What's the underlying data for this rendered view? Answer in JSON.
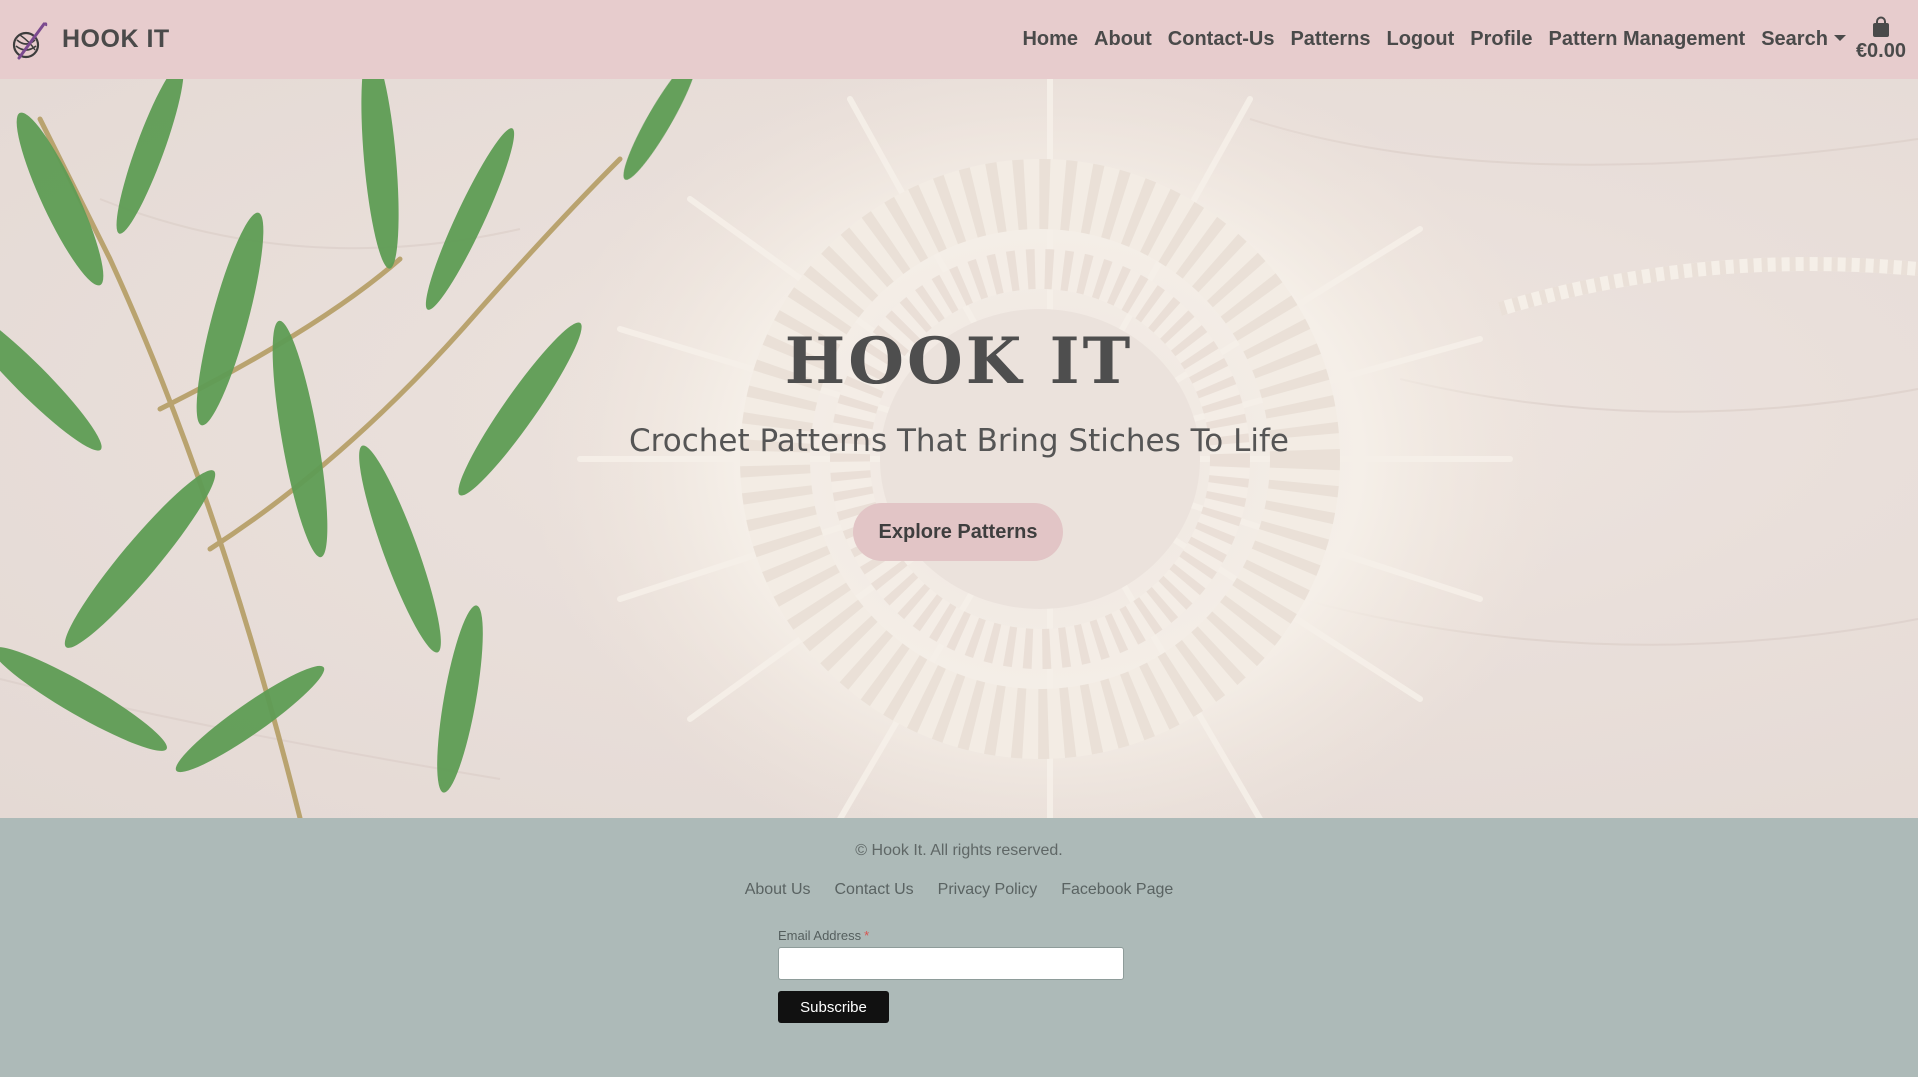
{
  "brand": {
    "name": "HOOK IT",
    "logo_icon": "crochet-hook-yarn-icon"
  },
  "nav": {
    "items": [
      {
        "label": "Home"
      },
      {
        "label": "About"
      },
      {
        "label": "Contact-Us"
      },
      {
        "label": "Patterns"
      },
      {
        "label": "Logout"
      },
      {
        "label": "Profile"
      },
      {
        "label": "Pattern Management"
      }
    ],
    "search_label": "Search",
    "cart_icon": "shopping-bag-icon",
    "cart_total": "€0.00"
  },
  "hero": {
    "title": "HOOK IT",
    "subtitle": "Crochet Patterns That Bring Stiches To Life",
    "cta_label": "Explore Patterns"
  },
  "footer": {
    "copyright": "© Hook It. All rights reserved.",
    "links": [
      {
        "label": "About Us"
      },
      {
        "label": "Contact Us"
      },
      {
        "label": "Privacy Policy"
      },
      {
        "label": "Facebook Page"
      }
    ],
    "email_label": "Email Address",
    "required_mark": "*",
    "email_value": "",
    "subscribe_label": "Subscribe"
  },
  "colors": {
    "navbar_bg": "#e7cccd",
    "footer_bg": "#adbab8",
    "cta_bg": "#e2c5c6",
    "subscribe_bg": "#111111"
  }
}
